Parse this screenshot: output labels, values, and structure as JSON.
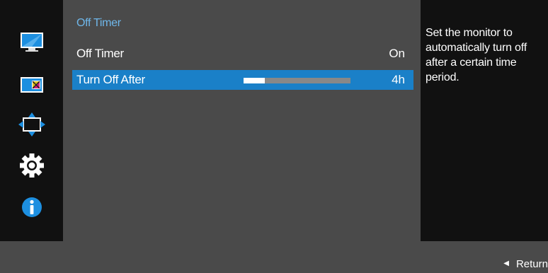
{
  "sidebar": {
    "icons": [
      {
        "name": "picture-icon",
        "selected": false
      },
      {
        "name": "color-icon",
        "selected": false
      },
      {
        "name": "screen-size-icon",
        "selected": false
      },
      {
        "name": "system-gear-icon",
        "selected": false
      },
      {
        "name": "information-icon",
        "selected": false
      }
    ]
  },
  "menu": {
    "title": "Off Timer",
    "rows": [
      {
        "label": "Off Timer",
        "value": "On"
      },
      {
        "label": "Turn Off After",
        "value": "4h",
        "slider_level": 0.2
      }
    ]
  },
  "description": {
    "text": "Set the monitor to automatically turn off after a certain time period."
  },
  "footer": {
    "return_label": "Return"
  },
  "colors": {
    "accent": "#1a80c8",
    "title": "#6fb7ea",
    "icon_blue": "#1d8fe0"
  }
}
